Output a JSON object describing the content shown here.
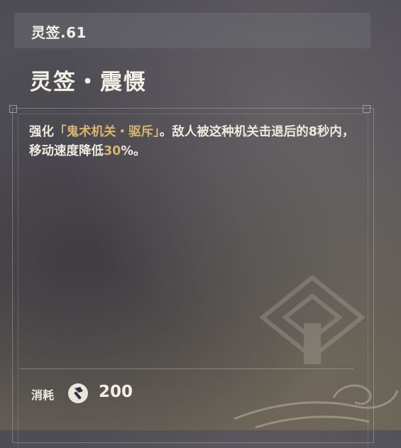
{
  "header": {
    "level_text": "灵签.61"
  },
  "title": "灵签・震慑",
  "description": {
    "prefix": "强化",
    "highlight": "「鬼术机关・驱斥」",
    "middle": "。敌人被这种机关击退后的8秒内，移动速度降低",
    "percent_value": "30",
    "suffix": "%。"
  },
  "cost": {
    "label": "消耗",
    "icon": "hammer-icon",
    "value": "200"
  },
  "colors": {
    "highlight": "#d8b56c",
    "text": "#eee9df"
  }
}
